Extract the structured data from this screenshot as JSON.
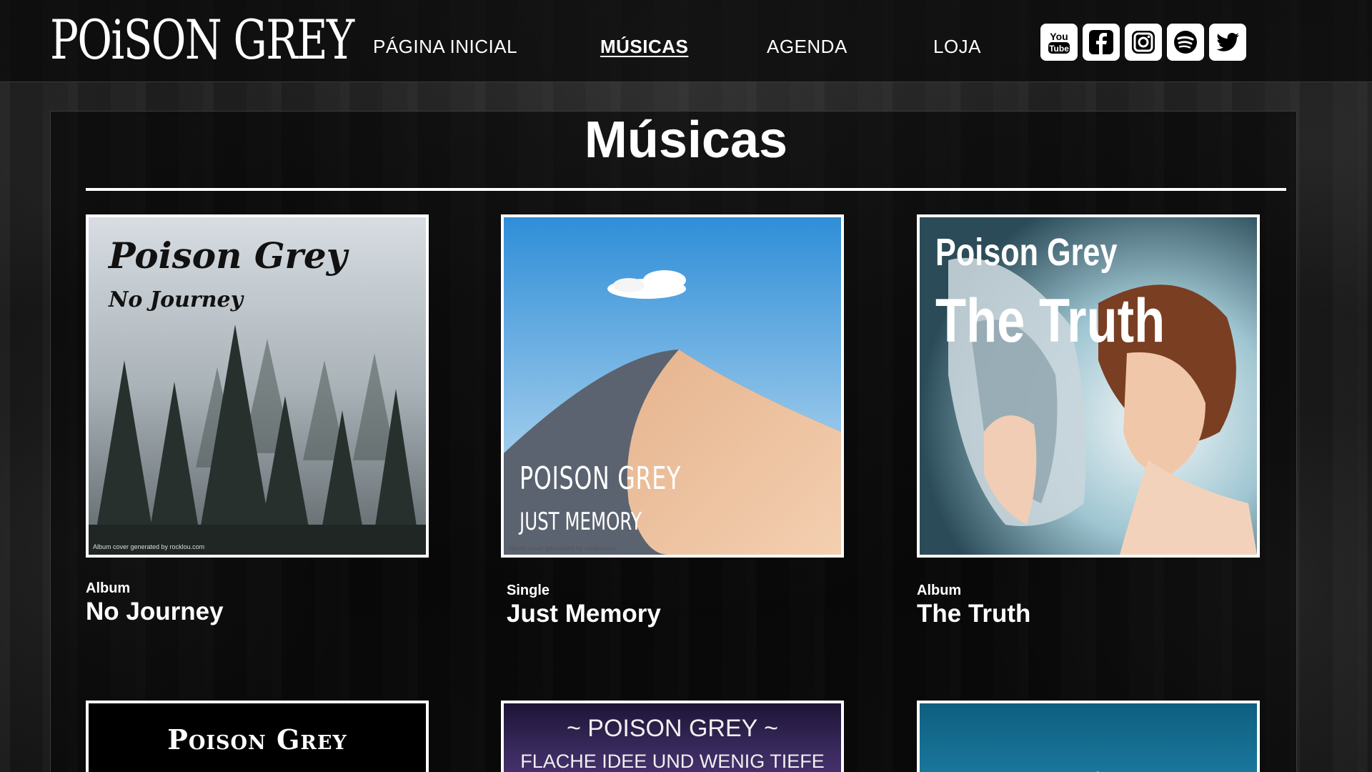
{
  "header": {
    "logo": "POiSON GREY",
    "nav": [
      {
        "label": "PÁGINA INICIAL",
        "active": false
      },
      {
        "label": "MÚSICAS",
        "active": true
      },
      {
        "label": "AGENDA",
        "active": false
      },
      {
        "label": "LOJA",
        "active": false
      }
    ],
    "social": [
      {
        "name": "youtube",
        "label": "You Tube"
      },
      {
        "name": "facebook",
        "label": "f"
      },
      {
        "name": "instagram",
        "label": ""
      },
      {
        "name": "spotify",
        "label": ""
      },
      {
        "name": "twitter",
        "label": ""
      }
    ]
  },
  "main": {
    "title": "Músicas",
    "releases": [
      {
        "type": "Album",
        "title": "No Journey",
        "cover_band": "Poison Grey",
        "cover_title": "No Journey",
        "cover_credit": "Album cover generated by rocklou.com"
      },
      {
        "type": "Single",
        "title": "Just Memory",
        "cover_band": "POISON GREY",
        "cover_title": "JUST MEMORY",
        "cover_credit": "Album cover generated by rocklo.com"
      },
      {
        "type": "Album",
        "title": "The Truth",
        "cover_band": "Poison Grey",
        "cover_title": "The Truth",
        "cover_credit": ""
      },
      {
        "cover_band": "Poison Grey"
      },
      {
        "cover_band": "~ POISON GREY ~",
        "cover_title": "FLACHE IDEE UND WENIG TIEFE"
      },
      {
        "cover_band": ""
      }
    ]
  },
  "colors": {
    "header_bg": "#080808",
    "accent": "#ffffff"
  }
}
